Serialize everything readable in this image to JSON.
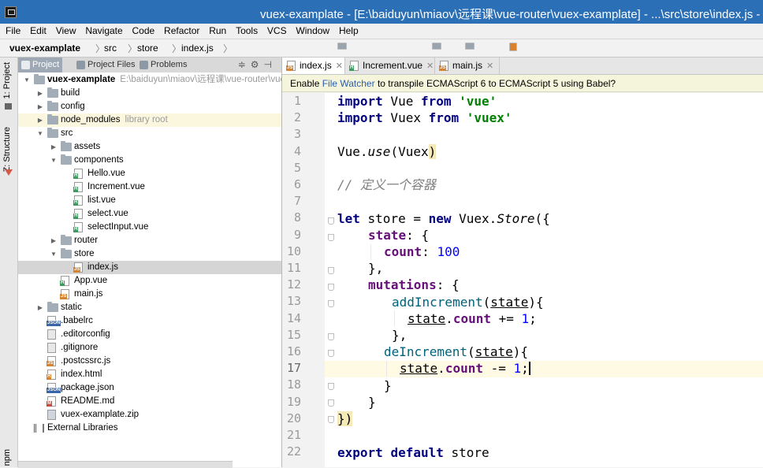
{
  "window": {
    "title": "vuex-examplate - [E:\\baiduyun\\miaov\\远程课\\vue-router\\vuex-examplate] - ...\\src\\store\\index.js - WebStorm"
  },
  "menu": [
    "File",
    "Edit",
    "View",
    "Navigate",
    "Code",
    "Refactor",
    "Run",
    "Tools",
    "VCS",
    "Window",
    "Help"
  ],
  "breadcrumb": [
    "vuex-examplate",
    "src",
    "store",
    "index.js"
  ],
  "tool_strip": {
    "project": "1: Project",
    "structure": "Z: Structure",
    "npm": "npm"
  },
  "project_panel": {
    "tabs": [
      "Project",
      "Project Files",
      "Problems"
    ],
    "tree": [
      {
        "label": "vuex-examplate",
        "hint": "E:\\baiduyun\\miaov\\远程课\\vue-router\\vuex-examplate",
        "depth": 0,
        "type": "folder",
        "expanded": true
      },
      {
        "label": "build",
        "depth": 1,
        "type": "folder",
        "expanded": false
      },
      {
        "label": "config",
        "depth": 1,
        "type": "folder",
        "expanded": false
      },
      {
        "label": "node_modules",
        "hint": "library root",
        "depth": 1,
        "type": "folder",
        "expanded": false
      },
      {
        "label": "src",
        "depth": 1,
        "type": "folder",
        "expanded": true
      },
      {
        "label": "assets",
        "depth": 2,
        "type": "folder",
        "expanded": false
      },
      {
        "label": "components",
        "depth": 2,
        "type": "folder",
        "expanded": true
      },
      {
        "label": "Hello.vue",
        "depth": 3,
        "type": "vue"
      },
      {
        "label": "Increment.vue",
        "depth": 3,
        "type": "vue"
      },
      {
        "label": "list.vue",
        "depth": 3,
        "type": "vue"
      },
      {
        "label": "select.vue",
        "depth": 3,
        "type": "vue"
      },
      {
        "label": "selectInput.vue",
        "depth": 3,
        "type": "vue"
      },
      {
        "label": "router",
        "depth": 2,
        "type": "folder",
        "expanded": false
      },
      {
        "label": "store",
        "depth": 2,
        "type": "folder",
        "expanded": true
      },
      {
        "label": "index.js",
        "depth": 3,
        "type": "js"
      },
      {
        "label": "App.vue",
        "depth": 2,
        "type": "vue"
      },
      {
        "label": "main.js",
        "depth": 2,
        "type": "js"
      },
      {
        "label": "static",
        "depth": 1,
        "type": "folder",
        "expanded": false
      },
      {
        "label": ".babelrc",
        "depth": 1,
        "type": "json"
      },
      {
        "label": ".editorconfig",
        "depth": 1,
        "type": "cfg"
      },
      {
        "label": ".gitignore",
        "depth": 1,
        "type": "cfg"
      },
      {
        "label": ".postcssrc.js",
        "depth": 1,
        "type": "js"
      },
      {
        "label": "index.html",
        "depth": 1,
        "type": "html"
      },
      {
        "label": "package.json",
        "depth": 1,
        "type": "json"
      },
      {
        "label": "README.md",
        "depth": 1,
        "type": "md"
      },
      {
        "label": "vuex-examplate.zip",
        "depth": 1,
        "type": "zip"
      },
      {
        "label": "External Libraries",
        "depth": 0,
        "type": "lib"
      }
    ]
  },
  "editor": {
    "tabs": [
      {
        "label": "index.js",
        "type": "js",
        "active": true
      },
      {
        "label": "Increment.vue",
        "type": "vue",
        "active": false
      },
      {
        "label": "main.js",
        "type": "js",
        "active": false
      }
    ],
    "notification": {
      "prefix": "Enable ",
      "link": "File Watcher",
      "suffix": " to transpile ECMAScript 6 to ECMAScript 5 using Babel?"
    },
    "line_numbers": [
      "1",
      "2",
      "3",
      "4",
      "5",
      "6",
      "7",
      "8",
      "9",
      "10",
      "11",
      "12",
      "13",
      "14",
      "15",
      "16",
      "17",
      "18",
      "19",
      "20",
      "21",
      "22"
    ],
    "current_line": 17,
    "code": {
      "l1": [
        "import",
        " Vue ",
        "from",
        " ",
        "'vue'"
      ],
      "l2": [
        "import",
        " Vuex ",
        "from",
        " ",
        "'vuex'"
      ],
      "l4": [
        "Vue.",
        "use",
        "(Vuex",
        ")"
      ],
      "l6": "// 定义一个容器",
      "l8": [
        "let",
        " store = ",
        "new",
        " Vuex.",
        "Store",
        "({"
      ],
      "l9": [
        "state",
        ": {"
      ],
      "l10": [
        "count",
        ": ",
        "100"
      ],
      "l11": "},",
      "l12": [
        "mutations",
        ": {"
      ],
      "l13": [
        "addIncrement",
        "(",
        "state",
        "){"
      ],
      "l14": [
        "state",
        ".",
        "count",
        " += ",
        "1",
        ";"
      ],
      "l15": "},",
      "l16": [
        "deIncrement",
        "(",
        "state",
        "){"
      ],
      "l17": [
        "state",
        ".",
        "count",
        " -= ",
        "1",
        ";"
      ],
      "l18": "}",
      "l19": "}",
      "l20": [
        "})"
      ],
      "l22": [
        "export",
        " ",
        "default",
        " store"
      ]
    }
  }
}
